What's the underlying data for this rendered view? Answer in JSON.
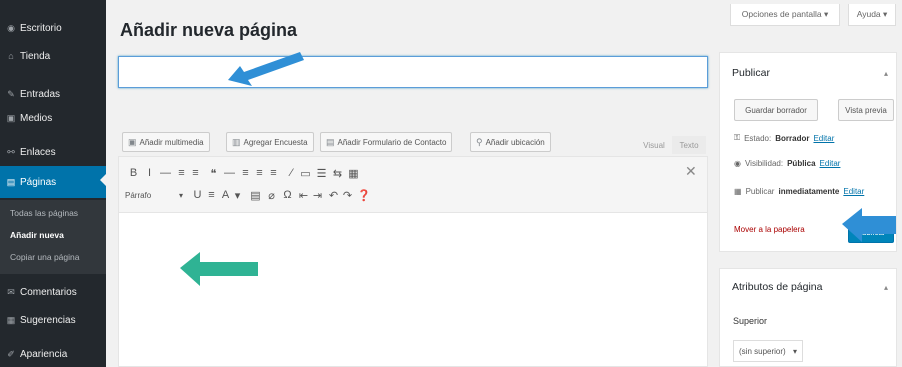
{
  "sidebar": {
    "items": [
      {
        "label": "Escritorio",
        "icon": "dashboard-icon",
        "glyph": "◉"
      },
      {
        "label": "Tienda",
        "icon": "store-icon",
        "glyph": "⌂"
      },
      {
        "label": "Entradas",
        "icon": "pin-icon",
        "glyph": "✎"
      },
      {
        "label": "Medios",
        "icon": "media-icon",
        "glyph": "▣"
      },
      {
        "label": "Enlaces",
        "icon": "link-icon",
        "glyph": "⚯"
      },
      {
        "label": "Páginas",
        "icon": "pages-icon",
        "glyph": "▤"
      },
      {
        "label": "Comentarios",
        "icon": "comments-icon",
        "glyph": "✉"
      },
      {
        "label": "Sugerencias",
        "icon": "suggestions-icon",
        "glyph": "▦"
      },
      {
        "label": "Apariencia",
        "icon": "appearance-icon",
        "glyph": "✐"
      }
    ],
    "submenu": [
      "Todas las páginas",
      "Añadir nueva",
      "Copiar una página"
    ]
  },
  "header": {
    "title": "Añadir nueva página",
    "screen_options": "Opciones de pantalla ▾",
    "help": "Ayuda ▾"
  },
  "title_input": {
    "value": "",
    "placeholder": ""
  },
  "media_buttons": [
    {
      "label": "Añadir multimedia",
      "icon": "media-add-icon",
      "glyph": "▣"
    },
    {
      "label": "Agregar Encuesta",
      "icon": "poll-icon",
      "glyph": "▥"
    },
    {
      "label": "Añadir Formulario de Contacto",
      "icon": "form-icon",
      "glyph": "▤"
    },
    {
      "label": "Añadir ubicación",
      "icon": "location-icon",
      "glyph": "⚲"
    }
  ],
  "editor_tabs": {
    "visual": "Visual",
    "text": "Texto"
  },
  "toolbar": {
    "row1": [
      "B",
      "I",
      "—",
      "≡",
      "≡",
      "❝",
      "—",
      "≡",
      "≡",
      "≡",
      "⁄",
      "▭",
      "☰",
      "⇆",
      "▦"
    ],
    "row1_names": [
      "bold-icon",
      "italic-icon",
      "strikethrough-icon",
      "bullet-list-icon",
      "numbered-list-icon",
      "blockquote-icon",
      "horizontal-line-icon",
      "align-left-icon",
      "align-center-icon",
      "align-right-icon",
      "link-insert-icon",
      "unlink-icon",
      "read-more-icon",
      "spellcheck-icon",
      "toolbar-toggle-icon"
    ],
    "row2": [
      "U",
      "≡",
      "A",
      "▾",
      "▤",
      "⌀",
      "Ω",
      "⇤",
      "⇥",
      "↶",
      "↷",
      "❓"
    ],
    "row2_names": [
      "underline-icon",
      "justify-icon",
      "text-color-icon",
      "color-dropdown-icon",
      "paste-text-icon",
      "clear-format-icon",
      "special-char-icon",
      "outdent-icon",
      "indent-icon",
      "undo-icon",
      "redo-icon",
      "help-icon"
    ],
    "format_label": "Párrafo",
    "format_arrow": "▾",
    "close_glyph": "✕"
  },
  "publish_box": {
    "title": "Publicar",
    "toggle": "▴",
    "save_draft": "Guardar borrador",
    "preview": "Vista previa",
    "status_label": "Estado:",
    "status_value": "Borrador",
    "visibility_label": "Visibilidad:",
    "visibility_value": "Pública",
    "publish_label": "Publicar",
    "publish_value": "inmediatamente",
    "edit": "Editar",
    "trash": "Mover a la papelera",
    "publish_button": "Publicar"
  },
  "attributes_box": {
    "title": "Atributos de página",
    "toggle": "▴",
    "parent_label": "Superior",
    "parent_value": "(sin superior)",
    "parent_arrow": "▾"
  },
  "annotations": {
    "arrow_color_blue": "#2f8fd6",
    "arrow_color_green": "#2fb394"
  }
}
